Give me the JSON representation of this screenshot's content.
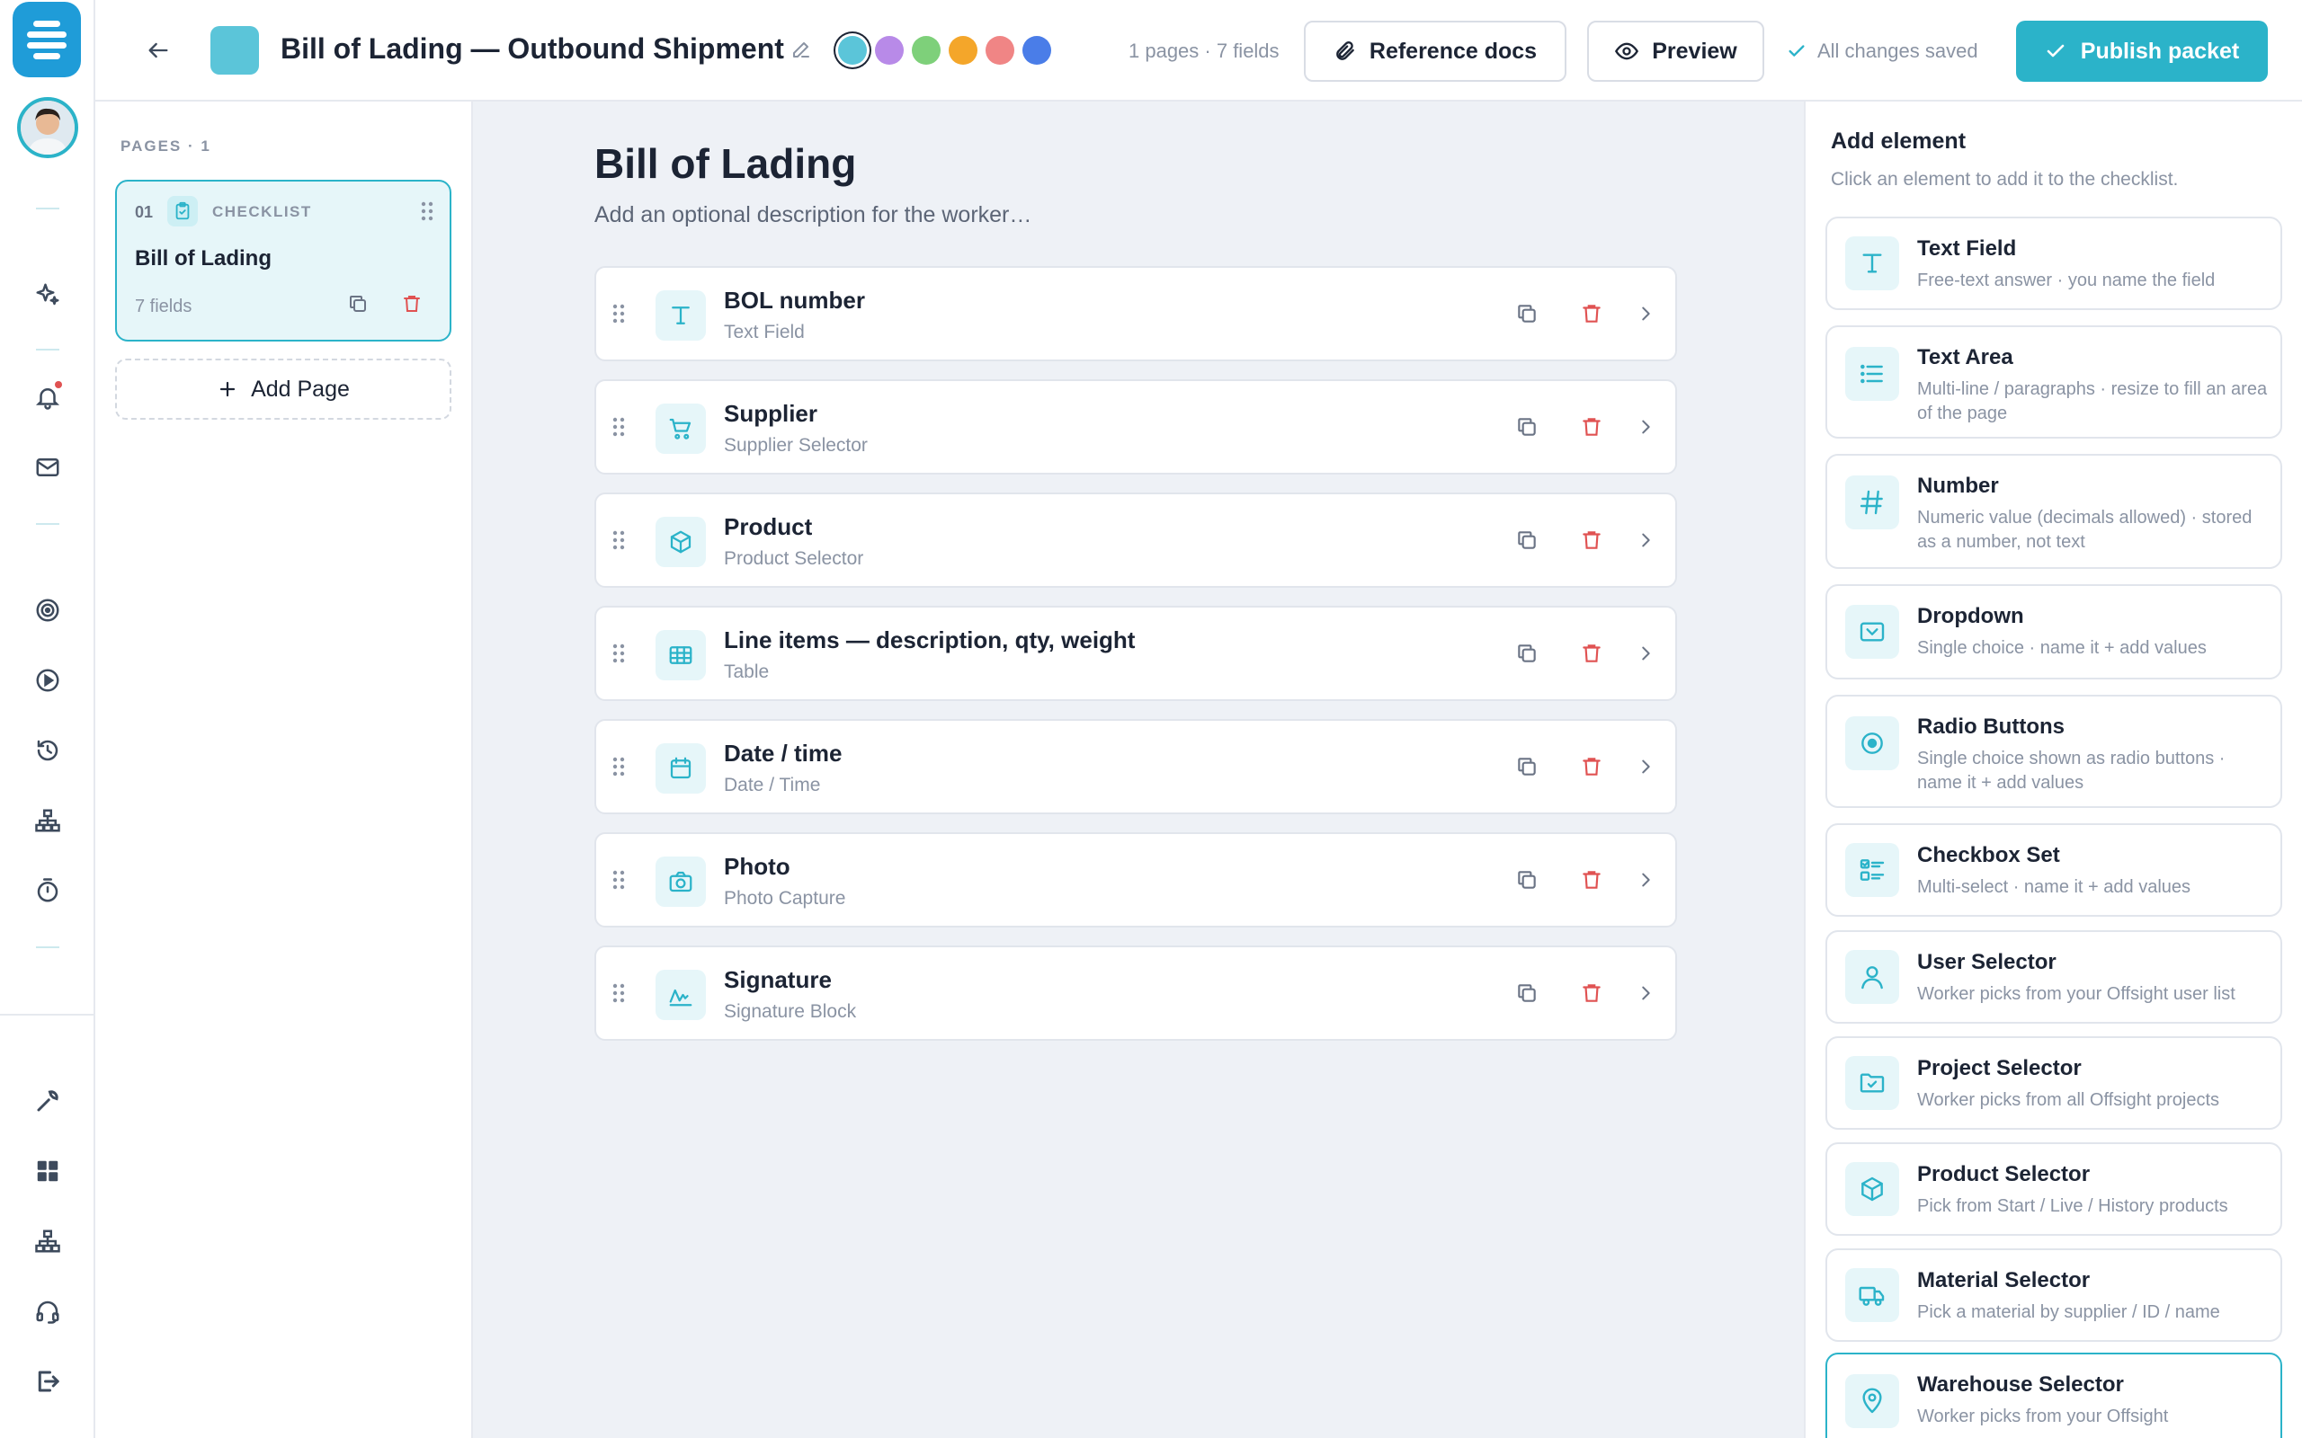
{
  "header": {
    "title": "Bill of Lading — Outbound Shipment",
    "swatch_color": "#5bc5d9",
    "colors": [
      "#5bc5d9",
      "#b88ae8",
      "#7ed07a",
      "#f4a62a",
      "#f08585",
      "#4a7de8"
    ],
    "count": "1 pages · 7 fields",
    "reference_docs": "Reference docs",
    "preview": "Preview",
    "saved_status": "All changes saved",
    "publish": "Publish packet"
  },
  "pages_panel": {
    "heading": "PAGES · 1",
    "pages": [
      {
        "number": "01",
        "type": "CHECKLIST",
        "title": "Bill of Lading",
        "fields": "7 fields"
      }
    ],
    "add_page": "Add Page"
  },
  "editor": {
    "title": "Bill of Lading",
    "description_placeholder": "Add an optional description for the worker…",
    "fields": [
      {
        "name": "BOL number",
        "type": "Text Field",
        "icon": "text-icon"
      },
      {
        "name": "Supplier",
        "type": "Supplier Selector",
        "icon": "cart-icon"
      },
      {
        "name": "Product",
        "type": "Product Selector",
        "icon": "box-icon"
      },
      {
        "name": "Line items — description, qty, weight",
        "type": "Table",
        "icon": "table-icon"
      },
      {
        "name": "Date / time",
        "type": "Date / Time",
        "icon": "calendar-icon"
      },
      {
        "name": "Photo",
        "type": "Photo Capture",
        "icon": "camera-icon"
      },
      {
        "name": "Signature",
        "type": "Signature Block",
        "icon": "signature-icon"
      }
    ]
  },
  "palette": {
    "title": "Add element",
    "subtitle": "Click an element to add it to the checklist.",
    "elements": [
      {
        "name": "Text Field",
        "desc": "Free-text answer · you name the field",
        "icon": "text-icon"
      },
      {
        "name": "Text Area",
        "desc": "Multi-line / paragraphs · resize to fill an area of the page",
        "icon": "lines-icon"
      },
      {
        "name": "Number",
        "desc": "Numeric value (decimals allowed) · stored as a number, not text",
        "icon": "hash-icon"
      },
      {
        "name": "Dropdown",
        "desc": "Single choice · name it + add values",
        "icon": "dropdown-icon"
      },
      {
        "name": "Radio Buttons",
        "desc": "Single choice shown as radio buttons · name it + add values",
        "icon": "radio-icon"
      },
      {
        "name": "Checkbox Set",
        "desc": "Multi-select · name it + add values",
        "icon": "checklist-icon"
      },
      {
        "name": "User Selector",
        "desc": "Worker picks from your Offsight user list",
        "icon": "user-icon"
      },
      {
        "name": "Project Selector",
        "desc": "Worker picks from all Offsight projects",
        "icon": "folder-icon"
      },
      {
        "name": "Product Selector",
        "desc": "Pick from Start / Live / History products",
        "icon": "box-icon"
      },
      {
        "name": "Material Selector",
        "desc": "Pick a material by supplier / ID / name",
        "icon": "truck-icon"
      },
      {
        "name": "Warehouse Selector",
        "desc": "Worker picks from your Offsight",
        "icon": "pin-icon"
      }
    ]
  },
  "colors": {
    "accent": "#2bb3c9",
    "danger": "#e05252",
    "canvas": "#eef1f6"
  }
}
